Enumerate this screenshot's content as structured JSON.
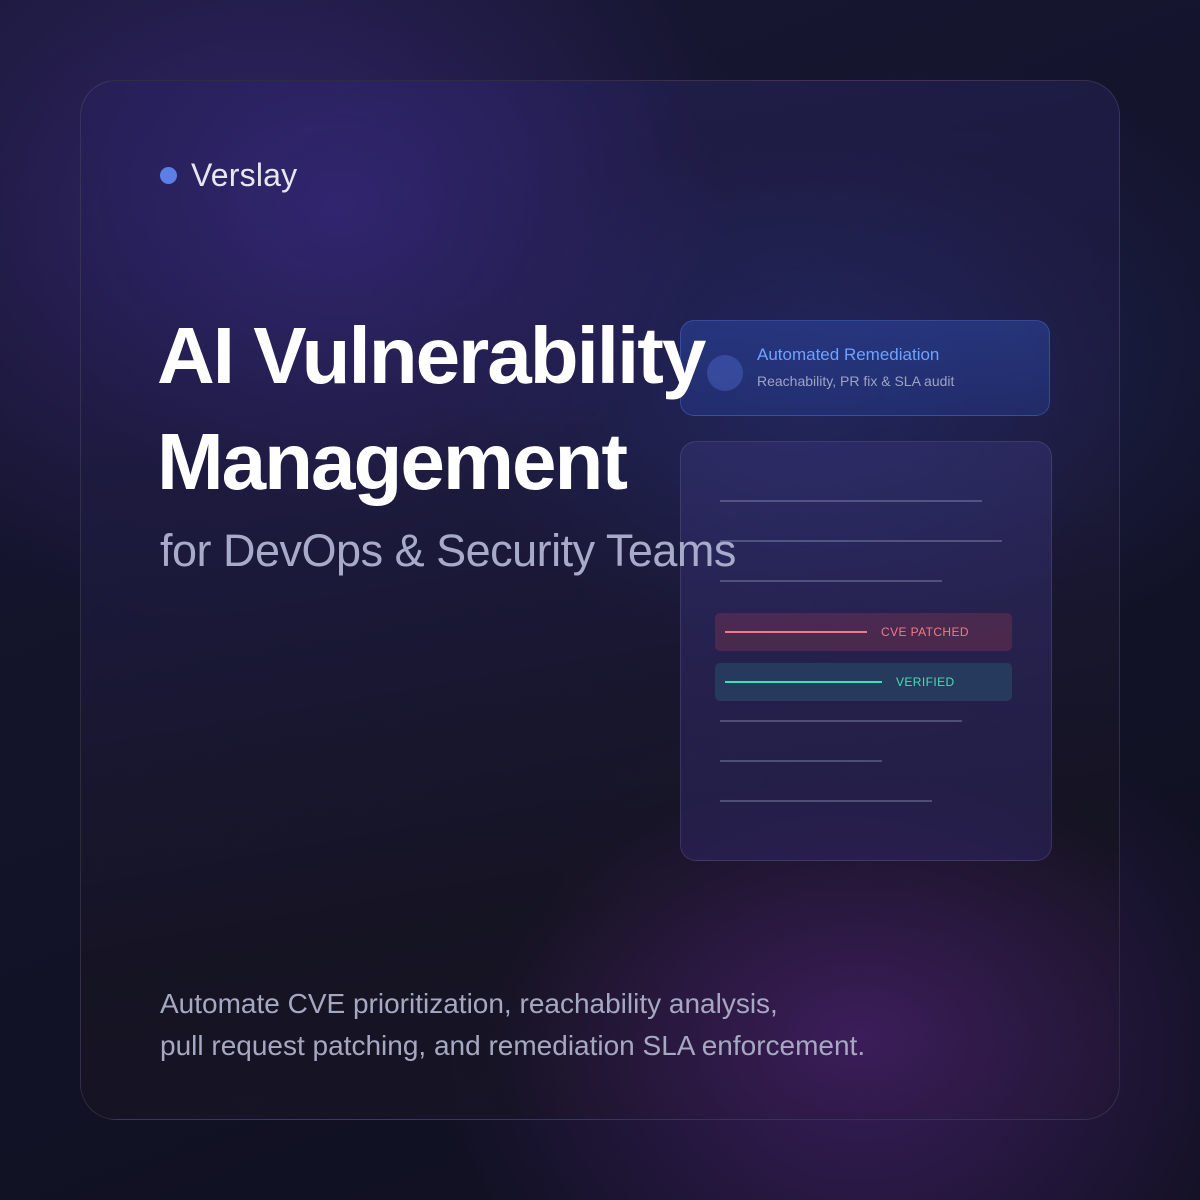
{
  "brand": {
    "name": "Verslay",
    "dot_color": "#5b7fe6"
  },
  "hero": {
    "title_line1": "AI Vulnerability",
    "title_line2": "Management",
    "subtitle": "for DevOps & Security Teams"
  },
  "remediation_card": {
    "title": "Automated Remediation",
    "description": "Reachability, PR fix & SLA audit",
    "accent_color": "#6ea2ff"
  },
  "status_rows": [
    {
      "label": "CVE PATCHED",
      "color": "#f07a86"
    },
    {
      "label": "VERIFIED",
      "color": "#3ee0b4"
    }
  ],
  "footer": {
    "line1": "Automate CVE prioritization, reachability analysis,",
    "line2": "pull request patching, and remediation SLA enforcement."
  }
}
